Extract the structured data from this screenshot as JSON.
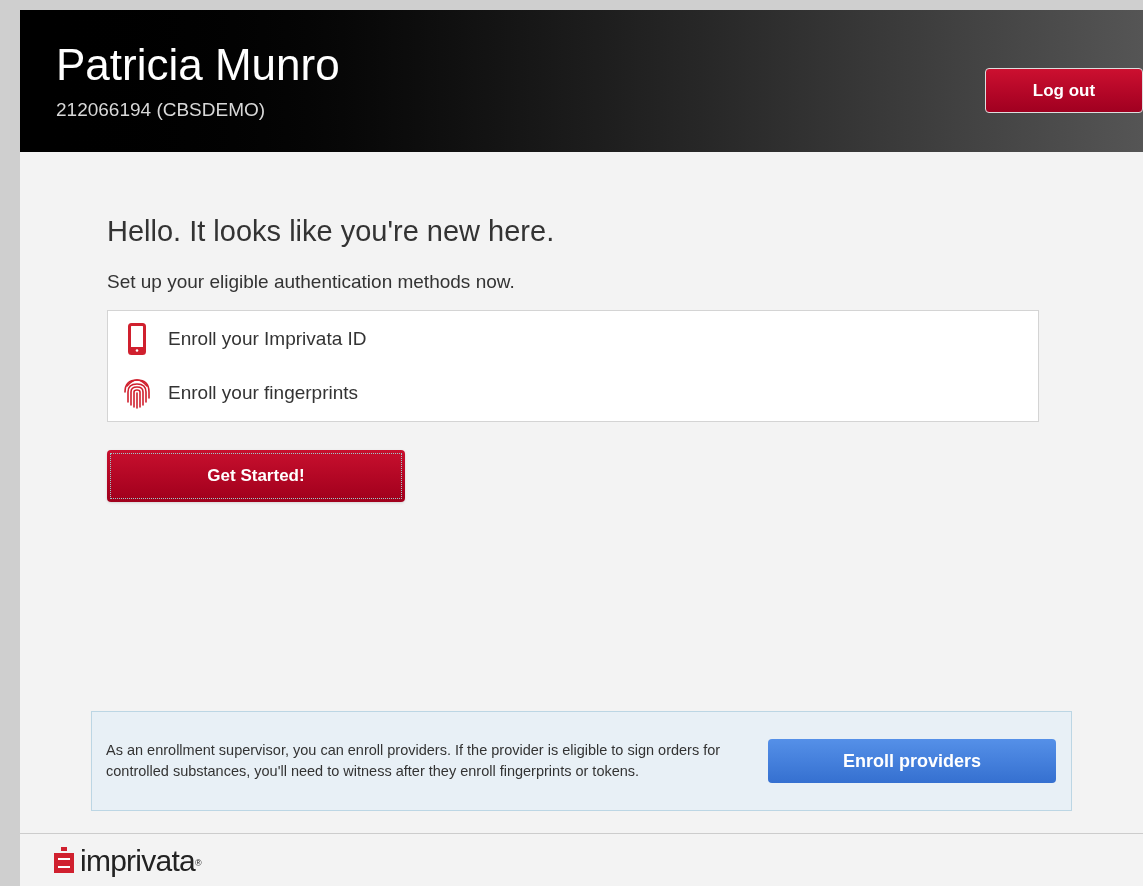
{
  "header": {
    "name": "Patricia Munro",
    "account": "212066194 (CBSDEMO)",
    "logout_button": "Log out"
  },
  "welcome": {
    "title": "Hello. It looks like you're new here.",
    "subtitle": "Set up your eligible authentication methods now.",
    "methods": [
      {
        "kind": "phone",
        "label": "Enroll your Imprivata ID"
      },
      {
        "kind": "fingerprint",
        "label": "Enroll your fingerprints"
      }
    ],
    "start_button": "Get Started!"
  },
  "supervisor_notice": {
    "text": "As an enrollment supervisor, you can enroll providers. If the provider is eligible to sign orders for controlled substances, you'll need to witness after they enroll fingerprints or tokens.",
    "button": "Enroll providers"
  },
  "footer": {
    "logo_text": "imprivata",
    "trademark": "®"
  }
}
